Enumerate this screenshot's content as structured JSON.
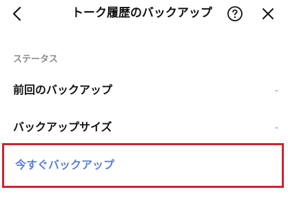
{
  "header": {
    "title": "トーク履歴のバックアップ",
    "back_icon": "chevron-left-icon",
    "help_icon": "help-circle-icon",
    "close_icon": "close-icon"
  },
  "section": {
    "label": "ステータス"
  },
  "rows": [
    {
      "label": "前回のバックアップ",
      "value": "-"
    },
    {
      "label": "バックアップサイズ",
      "value": "-"
    }
  ],
  "action": {
    "label": "今すぐバックアップ"
  },
  "colors": {
    "action_text": "#5b7fd6",
    "highlight_border": "#d0232a",
    "section_label": "#8a8a8a"
  }
}
